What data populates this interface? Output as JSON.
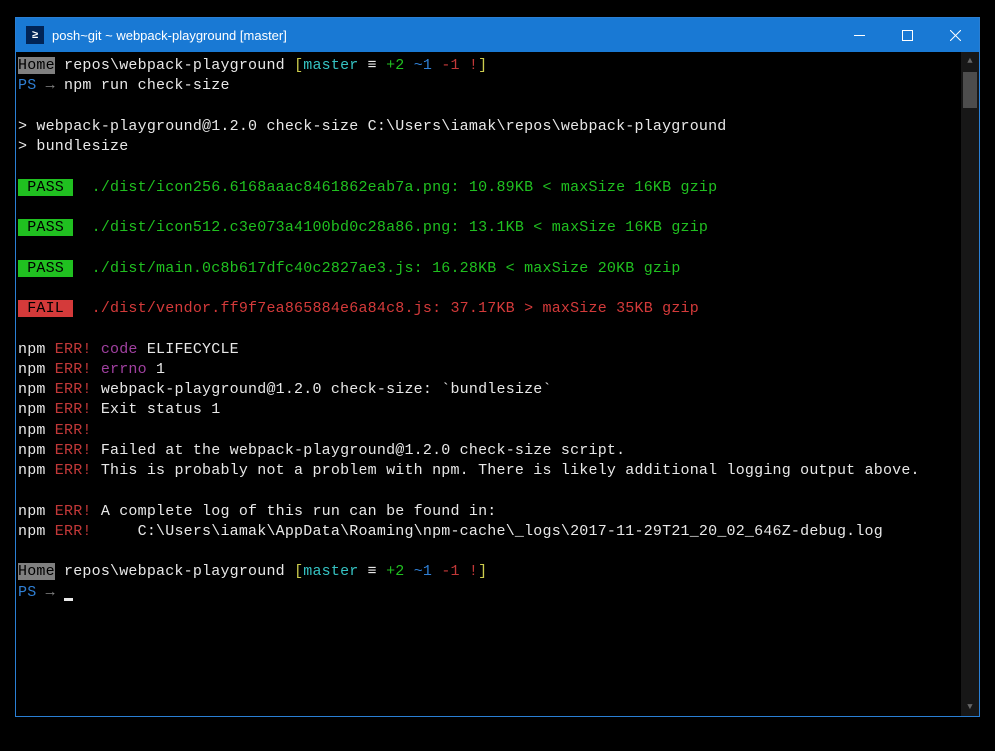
{
  "window": {
    "title": "posh~git ~ webpack-playground [master]"
  },
  "prompt1": {
    "home": "Home",
    "path": " repos\\webpack-playground ",
    "lbr": "[",
    "branch": "master",
    "eq": " ≡ ",
    "plus": "+2",
    "tilde": " ~1 ",
    "minus": "-1 ",
    "bang": "!",
    "rbr": "]",
    "ps": "PS",
    "arrow": " → ",
    "cmd": "npm run check-size"
  },
  "npm_banner": {
    "l1": "> webpack-playground@1.2.0 check-size C:\\Users\\iamak\\repos\\webpack-playground",
    "l2": "> bundlesize"
  },
  "results": [
    {
      "badge": " PASS ",
      "status": "pass",
      "text": "  ./dist/icon256.6168aaac8461862eab7a.png: 10.89KB < maxSize 16KB gzip"
    },
    {
      "badge": " PASS ",
      "status": "pass",
      "text": "  ./dist/icon512.c3e073a4100bd0c28a86.png: 13.1KB < maxSize 16KB gzip"
    },
    {
      "badge": " PASS ",
      "status": "pass",
      "text": "  ./dist/main.0c8b617dfc40c2827ae3.js: 16.28KB < maxSize 20KB gzip"
    },
    {
      "badge": " FAIL ",
      "status": "fail",
      "text": "  ./dist/vendor.ff9f7ea865884e6a84c8.js: 37.17KB > maxSize 35KB gzip"
    }
  ],
  "npm_err": {
    "npm": "npm",
    "err": " ERR!",
    "lines": [
      {
        "type": "kv",
        "key": " code",
        "val": " ELIFECYCLE"
      },
      {
        "type": "kv",
        "key": " errno",
        "val": " 1"
      },
      {
        "type": "msg",
        "text": " webpack-playground@1.2.0 check-size: `bundlesize`"
      },
      {
        "type": "msg",
        "text": " Exit status 1"
      },
      {
        "type": "msg",
        "text": ""
      },
      {
        "type": "msg",
        "text": " Failed at the webpack-playground@1.2.0 check-size script."
      },
      {
        "type": "msg",
        "text": " This is probably not a problem with npm. There is likely additional logging output above."
      }
    ],
    "loglines": [
      {
        "text": " A complete log of this run can be found in:"
      },
      {
        "text": "     C:\\Users\\iamak\\AppData\\Roaming\\npm-cache\\_logs\\2017-11-29T21_20_02_646Z-debug.log"
      }
    ]
  },
  "prompt2": {
    "home": "Home",
    "path": " repos\\webpack-playground ",
    "lbr": "[",
    "branch": "master",
    "eq": " ≡ ",
    "plus": "+2",
    "tilde": " ~1 ",
    "minus": "-1 ",
    "bang": "!",
    "rbr": "]",
    "ps": "PS",
    "arrow": " → "
  }
}
